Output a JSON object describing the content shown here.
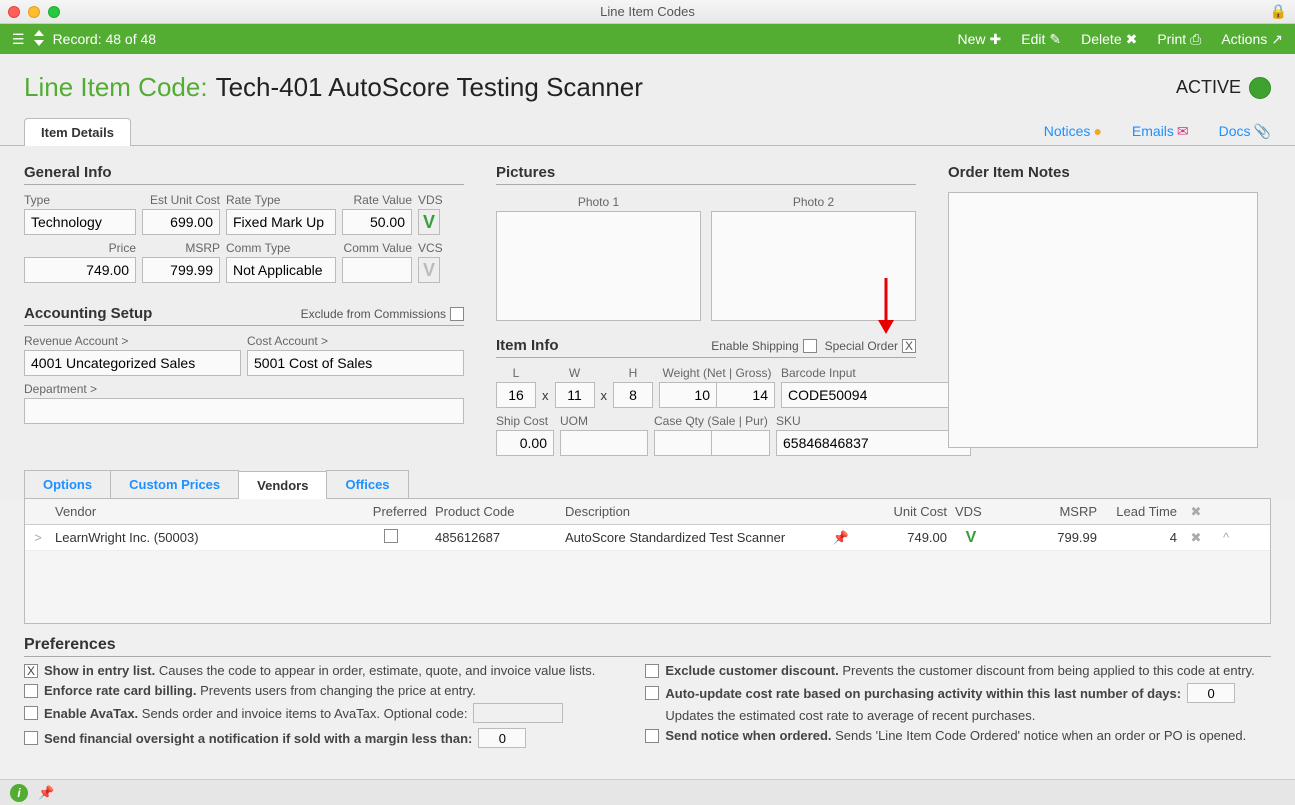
{
  "window": {
    "title": "Line Item Codes"
  },
  "greenbar": {
    "record": "Record: 48 of 48",
    "actions": {
      "new": "New",
      "edit": "Edit",
      "delete": "Delete",
      "print": "Print",
      "actions": "Actions"
    }
  },
  "page": {
    "title_label": "Line Item Code:",
    "title_value": "Tech-401 AutoScore Testing Scanner",
    "status": "ACTIVE"
  },
  "tabs": {
    "item_details": "Item Details"
  },
  "links": {
    "notices": "Notices",
    "emails": "Emails",
    "docs": "Docs"
  },
  "general": {
    "heading": "General Info",
    "labels": {
      "type": "Type",
      "est_cost": "Est Unit Cost",
      "rate_type": "Rate Type",
      "rate_value": "Rate Value",
      "vds": "VDS",
      "price": "Price",
      "msrp": "MSRP",
      "comm_type": "Comm Type",
      "comm_value": "Comm Value",
      "vcs": "VCS"
    },
    "type": "Technology",
    "est_cost": "699.00",
    "rate_type": "Fixed Mark Up",
    "rate_value": "50.00",
    "vds": "V",
    "price": "749.00",
    "msrp": "799.99",
    "comm_type": "Not Applicable",
    "comm_value": "",
    "vcs": "V"
  },
  "accounting": {
    "heading": "Accounting Setup",
    "exclude_label": "Exclude from Commissions",
    "labels": {
      "revenue": "Revenue Account >",
      "cost": "Cost Account >",
      "department": "Department >"
    },
    "revenue": "4001 Uncategorized Sales",
    "cost": "5001 Cost of Sales",
    "department": ""
  },
  "pictures": {
    "heading": "Pictures",
    "photo1": "Photo 1",
    "photo2": "Photo 2"
  },
  "item_info": {
    "heading": "Item Info",
    "enable_shipping": "Enable Shipping",
    "special_order": "Special Order",
    "special_order_checked": "X",
    "labels": {
      "L": "L",
      "W": "W",
      "H": "H",
      "weight": "Weight (Net | Gross)",
      "barcode": "Barcode Input",
      "ship_cost": "Ship Cost",
      "uom": "UOM",
      "case_qty": "Case Qty (Sale | Pur)",
      "sku": "SKU"
    },
    "L": "16",
    "W": "11",
    "H": "8",
    "weight_net": "10",
    "weight_gross": "14",
    "barcode": "CODE50094",
    "ship_cost": "0.00",
    "uom": "",
    "case_sale": "",
    "case_pur": "",
    "sku": "65846846837",
    "x_sep": "x"
  },
  "notes": {
    "heading": "Order Item Notes"
  },
  "subtabs": {
    "options": "Options",
    "custom_prices": "Custom Prices",
    "vendors": "Vendors",
    "offices": "Offices"
  },
  "vendor_table": {
    "columns": {
      "vendor": "Vendor",
      "preferred": "Preferred",
      "product_code": "Product Code",
      "description": "Description",
      "unit_cost": "Unit Cost",
      "vds": "VDS",
      "msrp": "MSRP",
      "lead_time": "Lead Time"
    },
    "row": {
      "vendor": "LearnWright Inc.  (50003)",
      "product_code": "485612687",
      "description": "AutoScore Standardized Test Scanner",
      "unit_cost": "749.00",
      "vds": "V",
      "msrp": "799.99",
      "lead_time": "4"
    }
  },
  "prefs": {
    "heading": "Preferences",
    "show_in_entry_bold": "Show in entry list.",
    "show_in_entry_desc": "Causes the code to appear in order, estimate, quote, and invoice value lists.",
    "enforce_bold": "Enforce rate card billing.",
    "enforce_desc": "Prevents users from changing the price at entry.",
    "avatax_bold": "Enable AvaTax.",
    "avatax_desc": "Sends order and invoice items to AvaTax. Optional code:",
    "margin_bold": "Send financial oversight a notification if sold with a margin less than:",
    "margin_value": "0",
    "exclude_bold": "Exclude customer discount.",
    "exclude_desc": "Prevents the customer discount from being applied to this code at entry.",
    "auto_bold": "Auto-update cost rate based on purchasing activity within this last number of days:",
    "auto_desc": "Updates the estimated cost rate to average of recent purchases.",
    "auto_value": "0",
    "notice_bold": "Send notice when ordered.",
    "notice_desc": "Sends 'Line Item Code Ordered' notice when an order or PO is opened.",
    "checked": "X"
  }
}
